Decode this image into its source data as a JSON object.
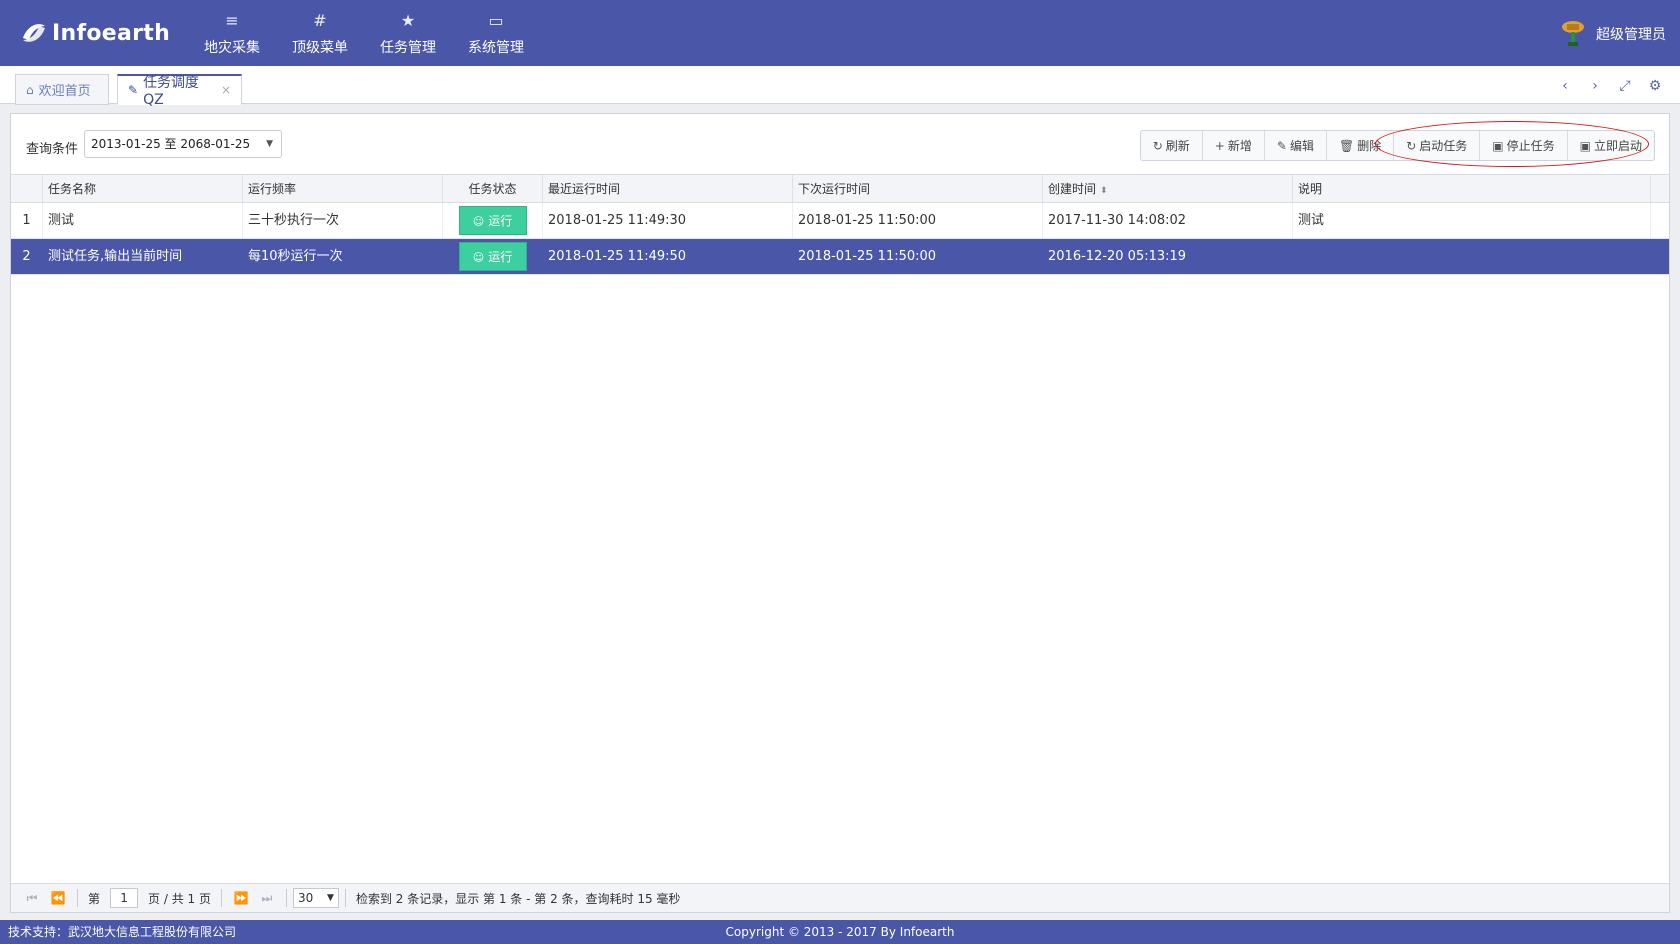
{
  "header": {
    "logo_text": "Infoearth",
    "nav": [
      {
        "label": "地灾采集",
        "icon": "≡"
      },
      {
        "label": "顶级菜单",
        "icon": "#"
      },
      {
        "label": "任务管理",
        "icon": "★"
      },
      {
        "label": "系统管理",
        "icon": "▭"
      }
    ],
    "user_name": "超级管理员"
  },
  "tabs": {
    "home": {
      "label": "欢迎首页",
      "icon": "⌂"
    },
    "active": {
      "label": "任务调度QZ",
      "icon": "✎",
      "close": "×"
    },
    "tools": [
      "‹",
      "›",
      "⤢",
      "⚙"
    ]
  },
  "toolbar": {
    "filter_label": "查询条件",
    "filter_value": "2013-01-25 至 2068-01-25",
    "buttons": [
      {
        "label": "刷新",
        "icon": "↻"
      },
      {
        "label": "新增",
        "icon": "+"
      },
      {
        "label": "编辑",
        "icon": "✎"
      },
      {
        "label": "删除",
        "icon": "🗑"
      },
      {
        "label": "启动任务",
        "icon": "↻"
      },
      {
        "label": "停止任务",
        "icon": "▣"
      },
      {
        "label": "立即启动",
        "icon": "▣"
      }
    ]
  },
  "grid": {
    "columns": [
      "任务名称",
      "运行频率",
      "任务状态",
      "最近运行时间",
      "下次运行时间",
      "创建时间",
      "说明"
    ],
    "sort_icon": "⬍",
    "rows": [
      {
        "num": "1",
        "name": "测试",
        "freq": "三十秒执行一次",
        "status": "运行",
        "last": "2018-01-25 11:49:30",
        "next": "2018-01-25 11:50:00",
        "created": "2017-11-30 14:08:02",
        "desc": "测试"
      },
      {
        "num": "2",
        "name": "测试任务,输出当前时间",
        "freq": "每10秒运行一次",
        "status": "运行",
        "last": "2018-01-25 11:49:50",
        "next": "2018-01-25 11:50:00",
        "created": "2016-12-20 05:13:19",
        "desc": ""
      }
    ]
  },
  "pager": {
    "page_prefix": "第",
    "page_value": "1",
    "page_suffix": "页 / 共 1 页",
    "page_size": "30",
    "summary": "检索到 2 条记录，显示 第 1 条 - 第 2 条，查询耗时 15 毫秒"
  },
  "footer": {
    "left": "技术支持：武汉地大信息工程股份有限公司",
    "center": "Copyright © 2013 - 2017 By Infoearth"
  },
  "colors": {
    "brand": "#4a56a8",
    "status_run": "#3ecf9f",
    "highlight": "#d01818"
  }
}
